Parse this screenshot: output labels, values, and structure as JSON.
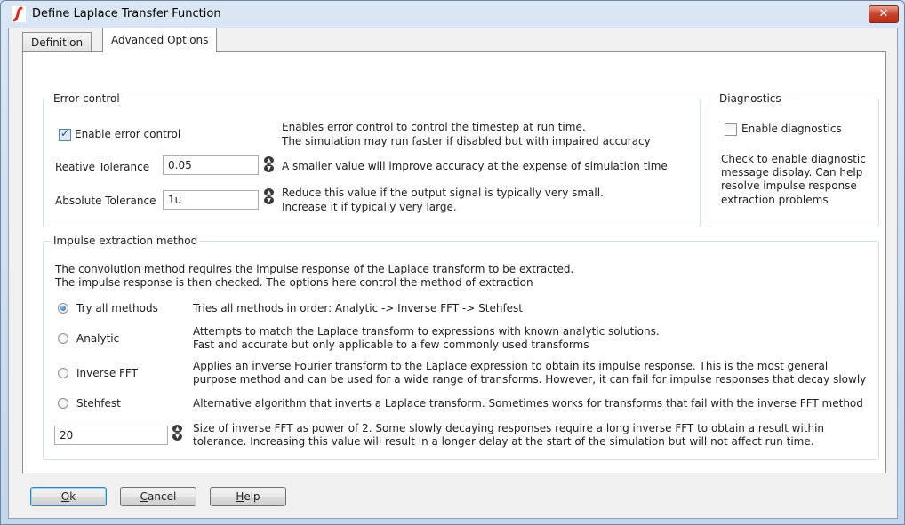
{
  "window": {
    "title": "Define Laplace Transfer Function",
    "close_label": "✕"
  },
  "tabs": [
    {
      "label": "Definition",
      "selected": false
    },
    {
      "label": "Advanced Options",
      "selected": true
    }
  ],
  "error_control": {
    "group_label": "Error control",
    "enable_label": "Enable error control",
    "enable_checked": true,
    "enable_desc_line1": "Enables error control to control the timestep at run time.",
    "enable_desc_line2": "The simulation may run faster if disabled but with impaired accuracy",
    "rel_tol_label": "Reative Tolerance",
    "rel_tol_value": "0.05",
    "rel_tol_desc": "A smaller value will improve accuracy at the expense of simulation time",
    "abs_tol_label": "Absolute Tolerance",
    "abs_tol_value": "1u",
    "abs_tol_desc_line1": "Reduce this value if the output signal is typically very small.",
    "abs_tol_desc_line2": "Increase it if typically very large."
  },
  "diagnostics": {
    "group_label": "Diagnostics",
    "enable_label": "Enable diagnostics",
    "enable_checked": false,
    "desc_lines": [
      "Check to enable diagnostic",
      "message display. Can help",
      "resolve impulse response",
      "extraction problems"
    ]
  },
  "impulse": {
    "group_label": "Impulse extraction method",
    "intro_line1": "The convolution method requires the impulse response of the Laplace transform to be extracted.",
    "intro_line2": "The impulse response is then checked. The options here control the method of extraction",
    "options": [
      {
        "label": "Try all methods",
        "checked": true,
        "desc_line1": "Tries all methods in order: Analytic -> Inverse FFT -> Stehfest",
        "desc_line2": ""
      },
      {
        "label": "Analytic",
        "checked": false,
        "desc_line1": "Attempts to match the Laplace transform to expressions with known analytic solutions.",
        "desc_line2": "Fast and accurate but only applicable to a few commonly used transforms"
      },
      {
        "label": "Inverse FFT",
        "checked": false,
        "desc_line1": "Applies an inverse Fourier transform to the Laplace expression to obtain its impulse response. This is the most general",
        "desc_line2": "purpose method and can be used for a wide range of transforms. However, it can fail for impulse responses that decay slowly"
      },
      {
        "label": "Stehfest",
        "checked": false,
        "desc_line1": "Alternative algorithm that inverts a Laplace transform. Sometimes works for transforms that fail with the inverse FFT method",
        "desc_line2": ""
      }
    ],
    "fft_size_value": "20",
    "fft_size_desc_line1": "Size of inverse FFT as power of 2. Some slowly decaying responses require a long inverse FFT to obtain a result within",
    "fft_size_desc_line2": "tolerance. Increasing this value will result in a longer delay at the start of the simulation but will not affect run time."
  },
  "buttons": {
    "ok_mnemonic": "O",
    "ok_rest": "k",
    "cancel_mnemonic": "C",
    "cancel_rest": "ancel",
    "help_mnemonic": "H",
    "help_rest": "elp"
  }
}
